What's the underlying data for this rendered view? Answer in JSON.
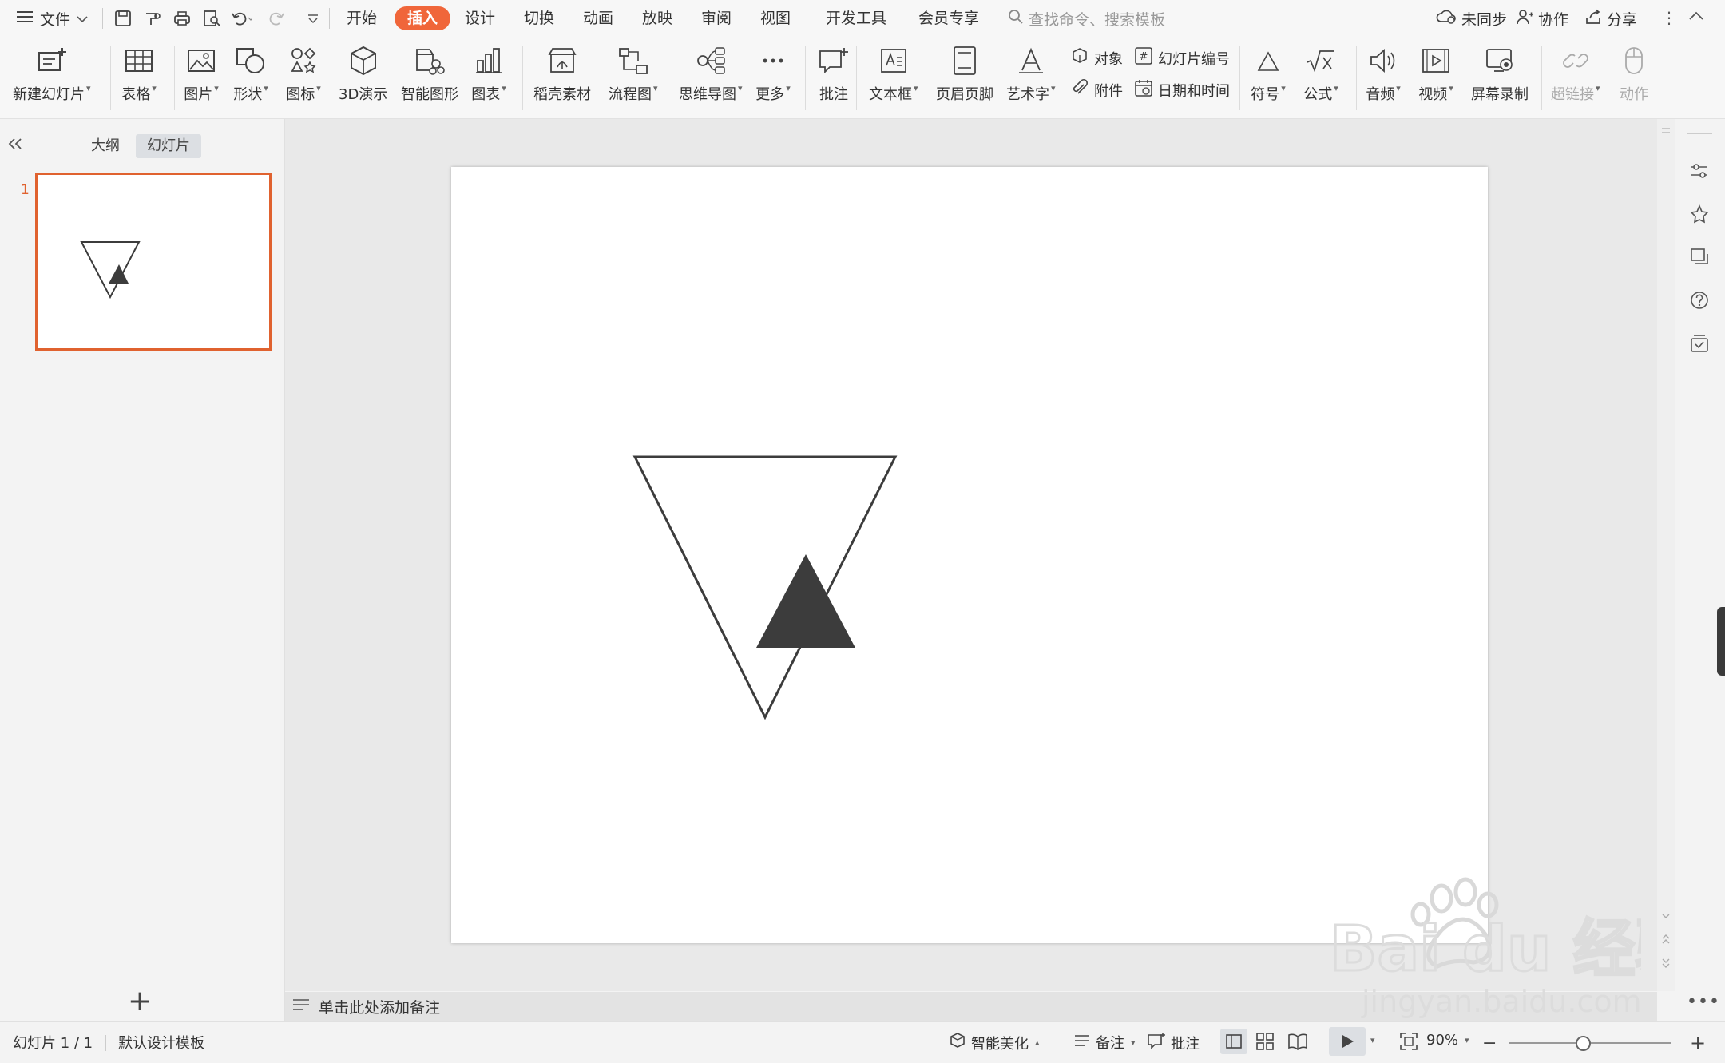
{
  "menubar": {
    "file_label": "文件",
    "tabs": [
      "开始",
      "插入",
      "设计",
      "切换",
      "动画",
      "放映",
      "审阅",
      "视图",
      "开发工具",
      "会员专享"
    ],
    "active_tab": "插入",
    "search_placeholder": "查找命令、搜索模板",
    "sync_label": "未同步",
    "collab_label": "协作",
    "share_label": "分享"
  },
  "ribbon": {
    "new_slide": "新建幻灯片",
    "table": "表格",
    "picture": "图片",
    "shape": "形状",
    "icon": "图标",
    "three_d": "3D演示",
    "smart_art": "智能图形",
    "chart": "图表",
    "docer": "稻壳素材",
    "flowchart": "流程图",
    "mindmap": "思维导图",
    "more": "更多",
    "comment": "批注",
    "textbox": "文本框",
    "header_footer": "页眉页脚",
    "wordart": "艺术字",
    "object": "对象",
    "slide_number": "幻灯片编号",
    "attachment": "附件",
    "date_time": "日期和时间",
    "symbol": "符号",
    "formula": "公式",
    "audio": "音频",
    "video": "视频",
    "screen_record": "屏幕录制",
    "hyperlink": "超链接",
    "action": "动作"
  },
  "panel": {
    "outline_tab": "大纲",
    "slides_tab": "幻灯片",
    "slide_number": "1"
  },
  "notes": {
    "placeholder": "单击此处添加备注"
  },
  "statusbar": {
    "slide_info": "幻灯片 1 / 1",
    "template": "默认设计模板",
    "beautify": "智能美化",
    "notes": "备注",
    "comments": "批注",
    "zoom": "90%"
  },
  "watermark": {
    "brand": "Bai du 经验",
    "url": "jingyan.baidu.com"
  },
  "colors": {
    "accent": "#f0663a",
    "selection": "#e0622f",
    "shape_fill": "#3c3c3c"
  }
}
